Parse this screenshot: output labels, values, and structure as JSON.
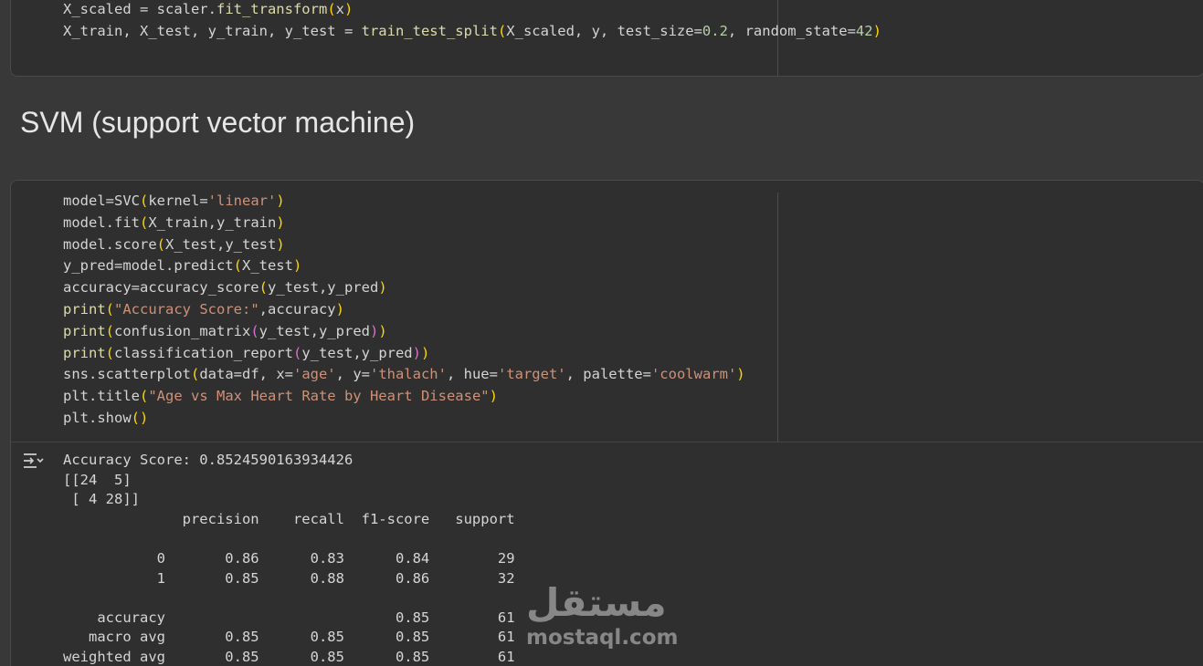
{
  "top_cell": {
    "code_lines": [
      [
        {
          "t": "X_scaled = scaler."
        },
        {
          "t": "fit_transform",
          "c": "fn"
        },
        {
          "t": "(",
          "c": "p1"
        },
        {
          "t": "x"
        },
        {
          "t": ")",
          "c": "p1"
        }
      ],
      [
        {
          "t": "X_train, X_test, y_train, y_test = "
        },
        {
          "t": "train_test_split",
          "c": "fn"
        },
        {
          "t": "(",
          "c": "p1"
        },
        {
          "t": "X_scaled, y, test_size="
        },
        {
          "t": "0.2",
          "c": "num"
        },
        {
          "t": ", random_state="
        },
        {
          "t": "42",
          "c": "num"
        },
        {
          "t": ")",
          "c": "p1"
        }
      ]
    ]
  },
  "section": {
    "heading": "SVM (support vector machine)"
  },
  "svm_cell": {
    "code_lines": [
      [
        {
          "t": "model=SVC"
        },
        {
          "t": "(",
          "c": "p1"
        },
        {
          "t": "kernel="
        },
        {
          "t": "'linear'",
          "c": "str"
        },
        {
          "t": ")",
          "c": "p1"
        }
      ],
      [
        {
          "t": "model.fit"
        },
        {
          "t": "(",
          "c": "p1"
        },
        {
          "t": "X_train,y_train"
        },
        {
          "t": ")",
          "c": "p1"
        }
      ],
      [
        {
          "t": "model.score"
        },
        {
          "t": "(",
          "c": "p1"
        },
        {
          "t": "X_test,y_test"
        },
        {
          "t": ")",
          "c": "p1"
        }
      ],
      [
        {
          "t": "y_pred=model.predict"
        },
        {
          "t": "(",
          "c": "p1"
        },
        {
          "t": "X_test"
        },
        {
          "t": ")",
          "c": "p1"
        }
      ],
      [
        {
          "t": "accuracy=accuracy_score"
        },
        {
          "t": "(",
          "c": "p1"
        },
        {
          "t": "y_test,y_pred"
        },
        {
          "t": ")",
          "c": "p1"
        }
      ],
      [
        {
          "t": "print",
          "c": "fn"
        },
        {
          "t": "(",
          "c": "p1"
        },
        {
          "t": "\"Accuracy Score:\"",
          "c": "str"
        },
        {
          "t": ",accuracy"
        },
        {
          "t": ")",
          "c": "p1"
        }
      ],
      [
        {
          "t": "print",
          "c": "fn"
        },
        {
          "t": "(",
          "c": "p1"
        },
        {
          "t": "confusion_matrix"
        },
        {
          "t": "(",
          "c": "p2"
        },
        {
          "t": "y_test,y_pred"
        },
        {
          "t": ")",
          "c": "p2"
        },
        {
          "t": ")",
          "c": "p1"
        }
      ],
      [
        {
          "t": "print",
          "c": "fn"
        },
        {
          "t": "(",
          "c": "p1"
        },
        {
          "t": "classification_report"
        },
        {
          "t": "(",
          "c": "p2"
        },
        {
          "t": "y_test,y_pred"
        },
        {
          "t": ")",
          "c": "p2"
        },
        {
          "t": ")",
          "c": "p1"
        }
      ],
      [
        {
          "t": "sns.scatterplot"
        },
        {
          "t": "(",
          "c": "p1"
        },
        {
          "t": "data=df, x="
        },
        {
          "t": "'age'",
          "c": "str"
        },
        {
          "t": ", y="
        },
        {
          "t": "'thalach'",
          "c": "str"
        },
        {
          "t": ", hue="
        },
        {
          "t": "'target'",
          "c": "str"
        },
        {
          "t": ", palette="
        },
        {
          "t": "'coolwarm'",
          "c": "str"
        },
        {
          "t": ")",
          "c": "p1"
        }
      ],
      [
        {
          "t": "plt.title"
        },
        {
          "t": "(",
          "c": "p1"
        },
        {
          "t": "\"Age vs Max Heart Rate by Heart Disease\"",
          "c": "str"
        },
        {
          "t": ")",
          "c": "p1"
        }
      ],
      [
        {
          "t": "plt.show"
        },
        {
          "t": "(",
          "c": "p1"
        },
        {
          "t": ")",
          "c": "p1"
        }
      ]
    ],
    "output_icon": "output-toggle-icon",
    "output_text": "Accuracy Score: 0.8524590163934426\n[[24  5]\n [ 4 28]]\n              precision    recall  f1-score   support\n\n           0       0.86      0.83      0.84        29\n           1       0.85      0.88      0.86        32\n\n    accuracy                           0.85        61\n   macro avg       0.85      0.85      0.85        61\nweighted avg       0.85      0.85      0.85        61"
  },
  "watermark": {
    "arabic": "مستقل",
    "latin": "mostaql.com"
  }
}
